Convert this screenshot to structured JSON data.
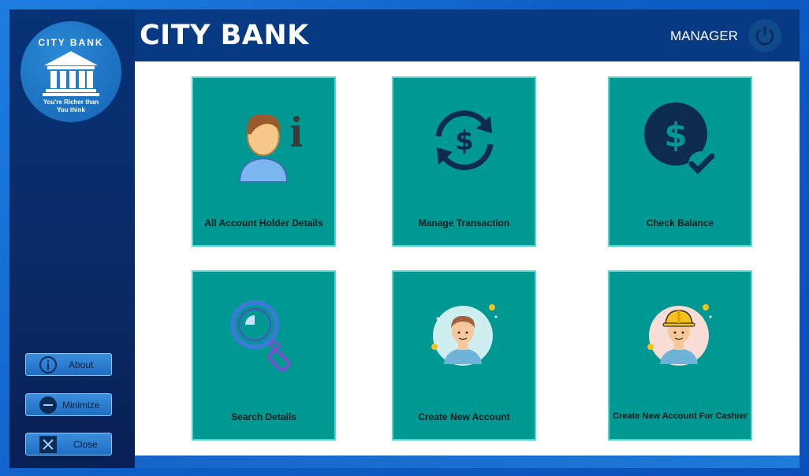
{
  "app": {
    "title": "CITY BANK",
    "role": "MANAGER"
  },
  "logo": {
    "top_text": "CITY BANK",
    "tagline_line1": "You're Richer than",
    "tagline_line2": "You think"
  },
  "sidebar": {
    "buttons": [
      {
        "label": "About",
        "icon": "info-icon"
      },
      {
        "label": "Minimize",
        "icon": "minus-icon"
      },
      {
        "label": "Close",
        "icon": "close-icon"
      }
    ]
  },
  "tiles": [
    {
      "label": "All Account Holder Details",
      "icon": "account-holder-info-icon"
    },
    {
      "label": "Manage Transaction",
      "icon": "dollar-exchange-icon"
    },
    {
      "label": "Check Balance",
      "icon": "dollar-check-icon"
    },
    {
      "label": "Search Details",
      "icon": "magnifier-icon"
    },
    {
      "label": "Create New Account",
      "icon": "new-user-avatar-icon"
    },
    {
      "label": "Create New Account For Cashier",
      "icon": "cashier-avatar-icon"
    }
  ],
  "colors": {
    "tile": "#009893",
    "header": "#073a82",
    "sidebar": "#063276"
  }
}
